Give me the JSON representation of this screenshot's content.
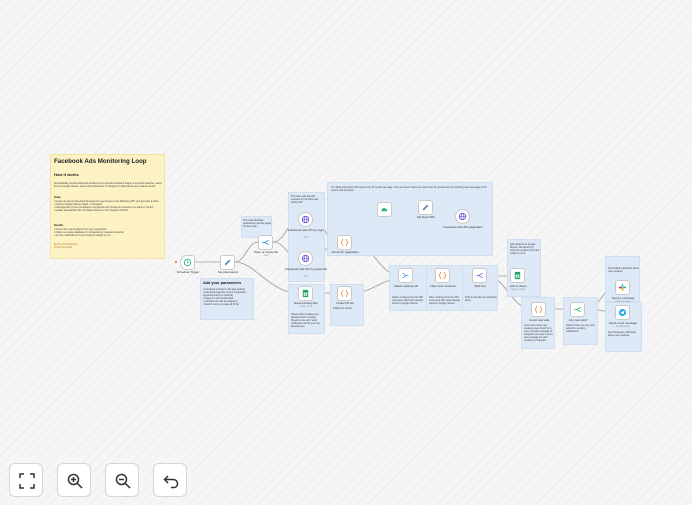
{
  "notes": {
    "main_title": "Facebook Ads Monitoring Loop",
    "main_subtitle": "How it works",
    "main_body": "Automatically monitors Meta Ads creatives from specific Facebook Pages or keyword searches, saves them to Google Sheets, and sends notifications to Telegram or Slack about new creatives found.",
    "setup_heading": "Setup",
    "setup_steps": "• Create an app on Facebook Developers to get access to the Marketing API, and generate a token\n• Connect Google Sheets, Slack, or Telegram\n• Add page IDs of your competitors or keywords and choose the countries you want to monitor\n• Update spreadsheet IDs, the Slack channel, or the Telegram chat ID",
    "benefits_heading": "Benefits",
    "benefits_body": "• Never miss new creatives from your competitors\n• Collect a creative database for competitors or relevant keywords\n• Get live notifications of new creatives straight to you",
    "author": "Built by Onur Boztekin\nProject & Growth",
    "params_title": "Add your parameters",
    "params_body": "• Facebook ad token in the App settings\n• Facebook page IDs of your competitors (keyword search is optional)\n• Pages the tool should track\n• Countries the ads are targeting\n• Search terms per page ad ID list",
    "loop_note": "This loop calls ads API requests for the Meta Ads Library API",
    "dedupe_note": "This node identifies duplicates to decide pages to keep track",
    "pagination_note": "The Meta Ads Library API returns only 25 results per page. Here we check if there are more than 25 results and if so, fetching each new page of 25 results until it finishes",
    "sheet_note": "Check which creatives are already listed in Google Sheets so we don't send notifications about ones we already have",
    "collect_note": "Collect the Ad IDs",
    "attach_note": "Attach creatives from the API responses with those already stored in Google Sheets",
    "filter_note": "Filter creatives from the API responses with those already stored in Google Sheets",
    "split_note": "Split out all ads into individual items",
    "add_sheet_note": "Add creatives to Google Sheets. We identify by using the creative body and rotate to count",
    "count_note": "Count how many new creatives were found for a more compact message to Telegram (no need to send one message for each creative) in Telegram",
    "anyads_note": "Check if there are any new ads left to sending notifications",
    "slack_note": "Send Slack notification about new creatives",
    "telegram_note": "Send Telegram notification about new creatives"
  },
  "nodes": {
    "schedule": {
      "label": "Schedule Trigger",
      "sub": ""
    },
    "set_params": {
      "label": "Set parameters",
      "sub": ""
    },
    "pages_kw": {
      "label": "Page or keywords",
      "sub": "rules"
    },
    "fb_page": {
      "label": "Facebook Ads API by page",
      "sub": "GET"
    },
    "fb_kw": {
      "label": "Facebook Ads API by keywords",
      "sub": "GET"
    },
    "read_sheet": {
      "label": "Read existing IDs",
      "sub": "getAll: sheet"
    },
    "check_pag": {
      "label": "Check for pagination",
      "sub": ""
    },
    "collect": {
      "label": "Collect ID list",
      "sub": ""
    },
    "wait": {
      "label": "",
      "sub": ""
    },
    "set_next": {
      "label": "Set Next URL",
      "sub": ""
    },
    "fb_pag": {
      "label": "Facebook Ads API pagination",
      "sub": "GET"
    },
    "attach": {
      "label": "Attach existing Ids",
      "sub": ""
    },
    "filter": {
      "label": "Filter new creatives",
      "sub": ""
    },
    "split": {
      "label": "Split Out",
      "sub": ""
    },
    "add_sheet": {
      "label": "Add to sheet",
      "sub": "append: sheet"
    },
    "count": {
      "label": "Count new ads",
      "sub": ""
    },
    "anyads": {
      "label": "Any new ads?",
      "sub": ""
    },
    "slack": {
      "label": "Send a message",
      "sub": "post: message"
    },
    "telegram": {
      "label": "Send a text message",
      "sub": "sendMessage"
    }
  },
  "toolbar": {
    "fit": "fit-view",
    "zoom_in": "zoom-in",
    "zoom_out": "zoom-out",
    "undo": "undo"
  }
}
